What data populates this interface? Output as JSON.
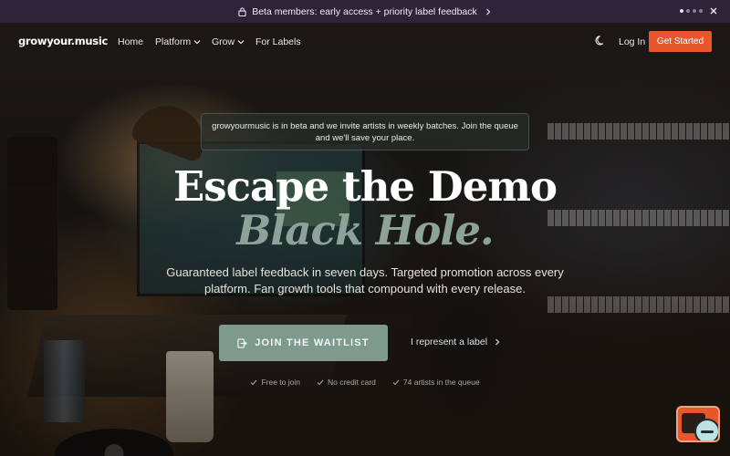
{
  "announcement": {
    "text": "Beta members: early access + priority label feedback",
    "icons": [
      "lock-icon",
      "chevron-right-icon",
      "close-icon"
    ],
    "carousel_dots": 4,
    "active_dot": 1
  },
  "nav": {
    "brand": "growyour.music",
    "items": [
      {
        "label": "Home",
        "has_dropdown": false
      },
      {
        "label": "Platform",
        "has_dropdown": true
      },
      {
        "label": "Grow",
        "has_dropdown": true
      },
      {
        "label": "For Labels",
        "has_dropdown": false
      }
    ],
    "theme_icon": "moon-icon",
    "login": "Log In",
    "cta": "Get Started"
  },
  "hero": {
    "notice": "growyourmusic is in beta and we invite artists in weekly batches. Join the queue and we'll save your place.",
    "headline_line1": "Escape the Demo",
    "headline_line2": "Black Hole.",
    "subheadline": "Guaranteed label feedback in seven days. Targeted promotion across every platform. Fan growth tools that compound with every release.",
    "primary_button": "JOIN THE WAITLIST",
    "secondary_link": "I represent a label",
    "checks": [
      "Free to join",
      "No credit card",
      "74 artists in the queue"
    ]
  },
  "colors": {
    "announcement_bg": "#2e2338",
    "cta": "#e8572c",
    "accent_green": "#7e9a8c",
    "headline_italic": "#8da39a"
  }
}
